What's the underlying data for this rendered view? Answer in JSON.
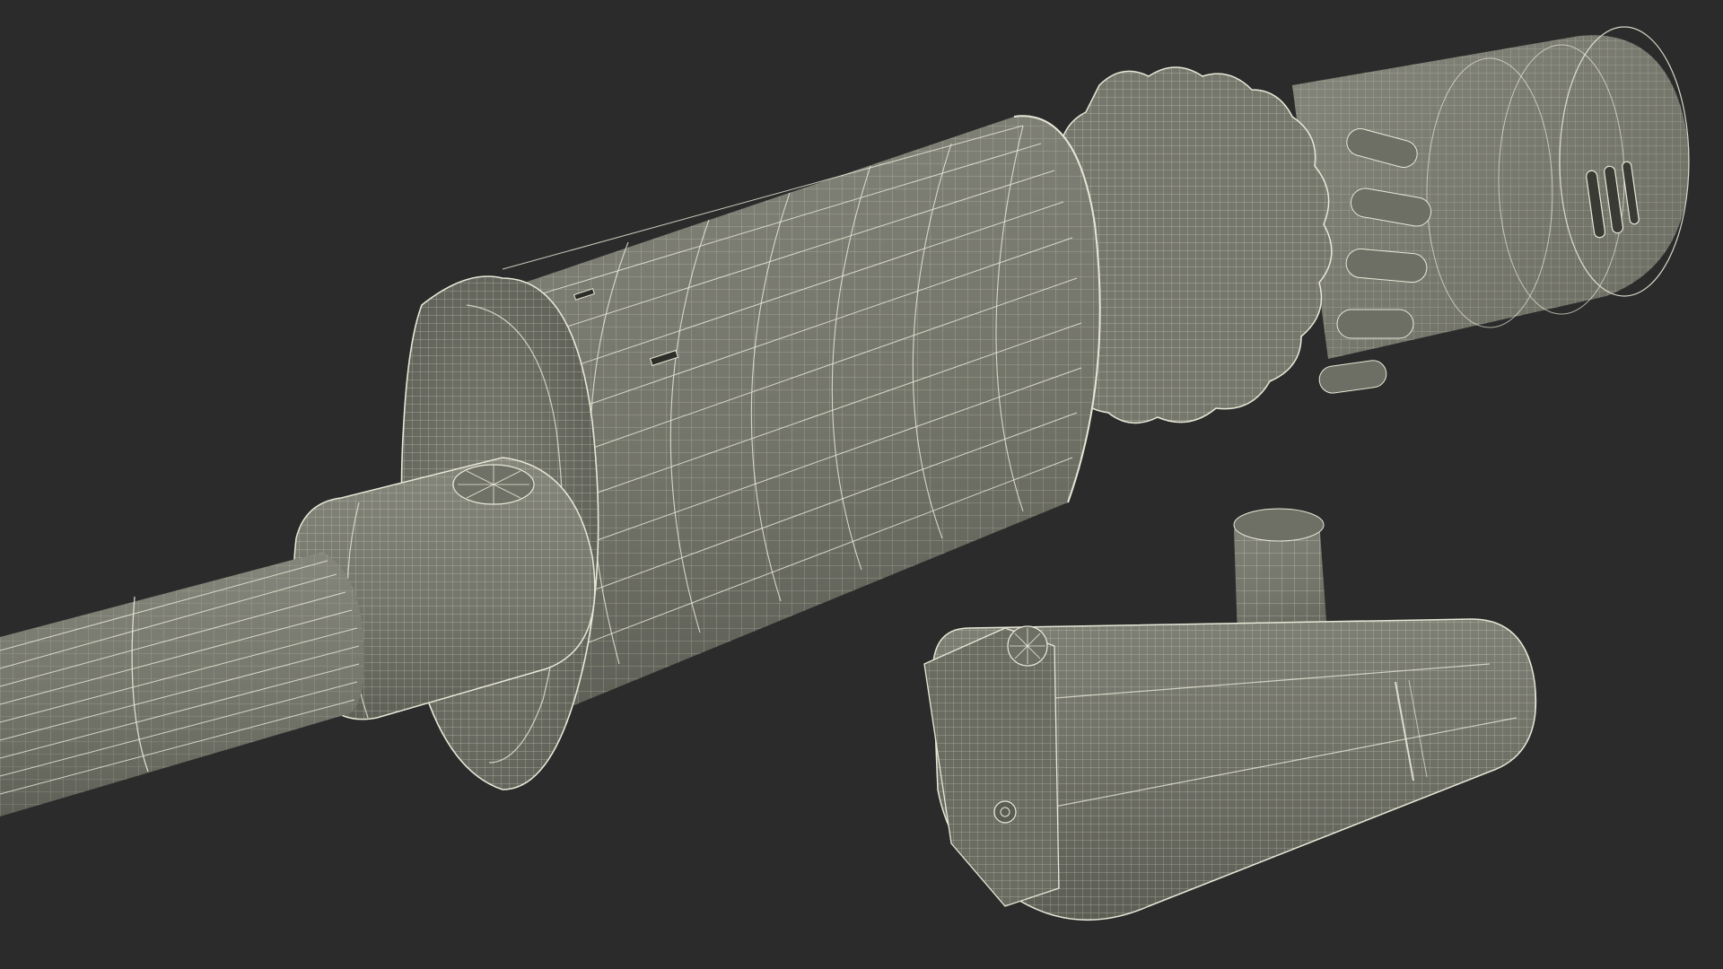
{
  "scene": {
    "background": "#2b2b2b",
    "surface_color": "#7a7b70",
    "surface_shadow": "#65665c",
    "surface_dark": "#55564d",
    "surface_light": "#8a8b80",
    "wire_color": "#e8e8d8"
  }
}
